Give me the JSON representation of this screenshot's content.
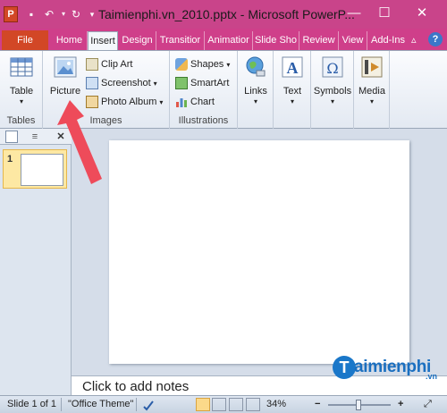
{
  "app": {
    "app_icon": "P",
    "title": "Taimienphi.vn_2010.pptx - Microsoft PowerP..."
  },
  "tabs": [
    "File",
    "Home",
    "Insert",
    "Design",
    "Transitior",
    "Animatior",
    "Slide Sho",
    "Review",
    "View",
    "Add-Ins"
  ],
  "ribbon": {
    "groups": {
      "tables": {
        "label": "Tables",
        "table": "Table"
      },
      "images": {
        "label": "Images",
        "picture": "Picture",
        "clip_art": "Clip Art",
        "screenshot": "Screenshot",
        "photo_album": "Photo Album"
      },
      "illustrations": {
        "label": "Illustrations",
        "shapes": "Shapes",
        "smartart": "SmartArt",
        "chart": "Chart"
      },
      "links": {
        "label": "Links"
      },
      "text": {
        "label": "Text"
      },
      "symbols": {
        "label": "Symbols"
      },
      "media": {
        "label": "Media"
      }
    }
  },
  "slides_pane": {
    "thumb_number": "1"
  },
  "notes": {
    "placeholder": "Click to add notes"
  },
  "status": {
    "slide_info": "Slide 1 of 1",
    "theme": "\"Office Theme\"",
    "zoom": "34%"
  },
  "watermark": {
    "brand": "aimienphi",
    "brand_initial": "T",
    "suffix": ".vn"
  },
  "colors": {
    "titlebar": "#c9448a",
    "file_tab": "#d24726",
    "arrow": "#ee4b5a"
  }
}
